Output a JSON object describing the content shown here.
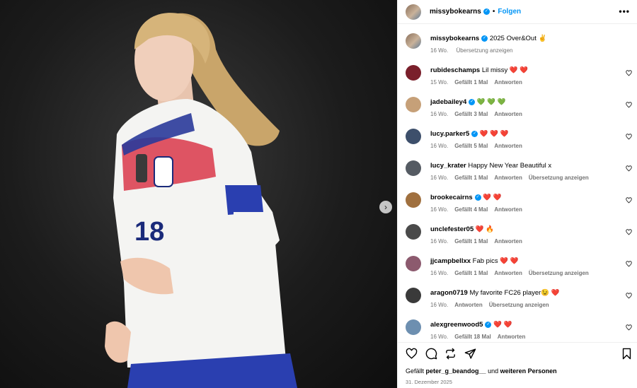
{
  "post": {
    "author": "missybokearns",
    "follow_label": "Folgen",
    "more_label": "•••",
    "caption": "2025 Over&Out ✌️",
    "caption_age": "16 Wo.",
    "caption_translate": "Übersetzung anzeigen",
    "jersey_number": "18",
    "likes_prefix": "Gefällt",
    "likes_user": "peter_g_beandog__",
    "likes_and": "und",
    "likes_rest": "weiteren Personen",
    "date": "31. Dezember 2025"
  },
  "comments": [
    {
      "user": "rubideschamps",
      "verified": false,
      "text": "Lil missy",
      "emoji": "❤️ ❤️",
      "emoji_color": "#ed4956",
      "age": "15 Wo.",
      "likes": "Gefällt 1 Mal",
      "reply": "Antworten",
      "translate": "",
      "avatar": "#7a1f2b"
    },
    {
      "user": "jadebailey4",
      "verified": true,
      "text": "",
      "emoji": "💚 💚 💚",
      "emoji_color": "#2ec05a",
      "age": "16 Wo.",
      "likes": "Gefällt 3 Mal",
      "reply": "Antworten",
      "translate": "",
      "avatar": "#c6a078"
    },
    {
      "user": "lucy.parker5",
      "verified": true,
      "text": "",
      "emoji": "❤️ ❤️ ❤️",
      "emoji_color": "#ed4956",
      "age": "16 Wo.",
      "likes": "Gefällt 5 Mal",
      "reply": "Antworten",
      "translate": "",
      "avatar": "#3d4f6b"
    },
    {
      "user": "lucy_krater",
      "verified": false,
      "text": "Happy New Year Beautiful x",
      "emoji": "",
      "emoji_color": "#ed4956",
      "age": "16 Wo.",
      "likes": "Gefällt 1 Mal",
      "reply": "Antworten",
      "translate": "Übersetzung anzeigen",
      "avatar": "#555b63"
    },
    {
      "user": "brookecairns",
      "verified": true,
      "text": "",
      "emoji": "❤️ ❤️",
      "emoji_color": "#ed4956",
      "age": "16 Wo.",
      "likes": "Gefällt 4 Mal",
      "reply": "Antworten",
      "translate": "",
      "avatar": "#a0703f"
    },
    {
      "user": "unclefester05",
      "verified": false,
      "text": "",
      "emoji": "❤️ 🔥",
      "emoji_color": "#ed4956",
      "age": "16 Wo.",
      "likes": "Gefällt 1 Mal",
      "reply": "Antworten",
      "translate": "",
      "avatar": "#4a4a4a"
    },
    {
      "user": "jjcampbellxx",
      "verified": false,
      "text": "Fab pics",
      "emoji": "❤️ ❤️",
      "emoji_color": "#ed4956",
      "age": "16 Wo.",
      "likes": "Gefällt 1 Mal",
      "reply": "Antworten",
      "translate": "Übersetzung anzeigen",
      "avatar": "#8c5a6e"
    },
    {
      "user": "aragon0719",
      "verified": false,
      "text": "My favorite FC26 player😉",
      "emoji": "❤️",
      "emoji_color": "#ed4956",
      "age": "16 Wo.",
      "likes": "",
      "reply": "Antworten",
      "translate": "Übersetzung anzeigen",
      "avatar": "#3a3a3a"
    },
    {
      "user": "alexgreenwood5",
      "verified": true,
      "text": "",
      "emoji": "❤️ ❤️",
      "emoji_color": "#ed4956",
      "age": "16 Wo.",
      "likes": "Gefällt 18 Mal",
      "reply": "Antworten",
      "translate": "",
      "avatar": "#6d8fb0"
    }
  ],
  "icons": {
    "like": "heart-icon",
    "comment": "comment-icon",
    "share": "repost-icon",
    "send": "send-icon",
    "save": "bookmark-icon",
    "next": "chevron-right-icon"
  }
}
